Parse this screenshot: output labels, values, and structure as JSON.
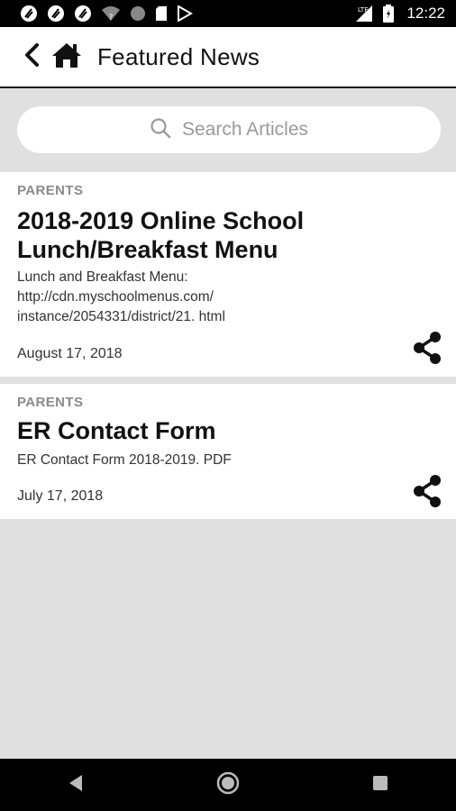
{
  "status_bar": {
    "time": "12:22",
    "network": "LTE",
    "left_icons": [
      "app-notification-icon",
      "app-notification-icon",
      "app-notification-icon",
      "wifi-unknown-icon",
      "circle-icon",
      "sd-card-icon",
      "play-store-icon"
    ],
    "right_icons": [
      "signal-icon",
      "battery-icon"
    ]
  },
  "header": {
    "title": "Featured News",
    "back_icon": "chevron-left-icon",
    "home_icon": "home-icon"
  },
  "search": {
    "placeholder": "Search Articles",
    "icon": "search-icon"
  },
  "articles": [
    {
      "category": "PARENTS",
      "title_lines": [
        "2018-2019 Online School",
        "Lunch/Breakfast Menu"
      ],
      "body_lines": [
        "Lunch and Breakfast Menu:",
        "http://cdn.myschoolmenus.com/",
        "instance/2054331/district/21. html"
      ],
      "date": "August 17, 2018",
      "share_icon": "share-icon"
    },
    {
      "category": "PARENTS",
      "title_lines": [
        "ER Contact Form"
      ],
      "body_lines": [
        "ER Contact Form 2018-2019. PDF"
      ],
      "date": "July 17, 2018",
      "share_icon": "share-icon"
    }
  ],
  "nav_bar": {
    "buttons": [
      "back-triangle-icon",
      "home-circle-icon",
      "recents-square-icon"
    ]
  }
}
